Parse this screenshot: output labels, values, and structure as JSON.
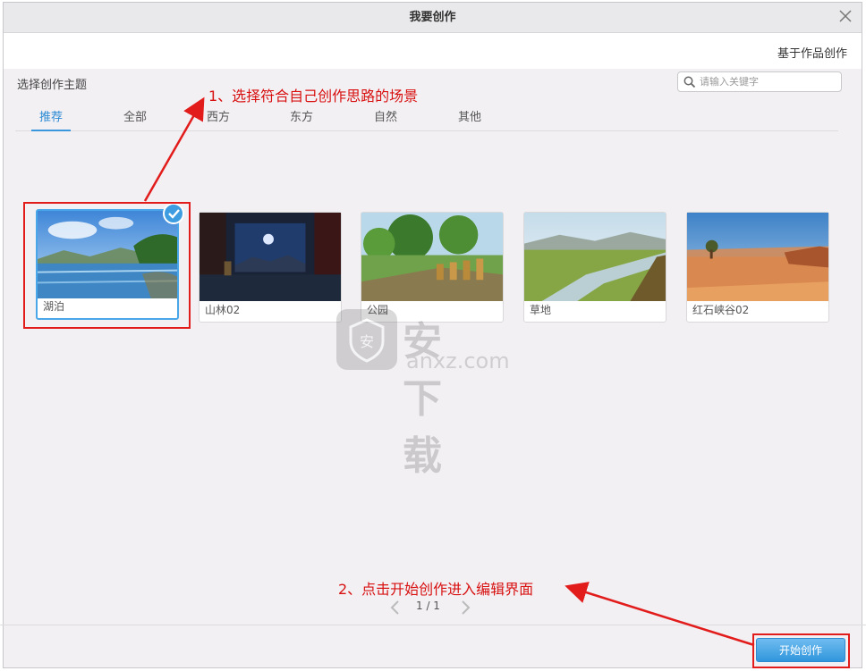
{
  "dialog": {
    "title": "我要创作",
    "from_work": "基于作品创作"
  },
  "section_title": "选择创作主题",
  "search": {
    "placeholder": "请输入关键字"
  },
  "tabs": [
    {
      "label": "推荐",
      "active": true
    },
    {
      "label": "全部"
    },
    {
      "label": "西方"
    },
    {
      "label": "东方"
    },
    {
      "label": "自然"
    },
    {
      "label": "其他"
    }
  ],
  "scenes": [
    {
      "name": "湖泊",
      "selected": true
    },
    {
      "name": "山林02"
    },
    {
      "name": "公园"
    },
    {
      "name": "草地"
    },
    {
      "name": "红石峡谷02"
    }
  ],
  "pager": {
    "text": "1 / 1"
  },
  "start_button": "开始创作",
  "annotations": {
    "step1": "1、选择符合自己创作思路的场景",
    "step2": "2、点击开始创作进入编辑界面"
  },
  "watermark": {
    "text": "安下载",
    "domain": "anxz.com",
    "badge": "安"
  },
  "colors": {
    "accent": "#3a96dd",
    "annotation": "#e21b1b",
    "button": "#3196dc"
  }
}
